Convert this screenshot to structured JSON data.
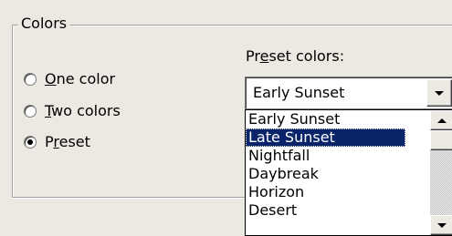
{
  "group": {
    "legend": "Colors"
  },
  "radios": [
    {
      "prefix": "",
      "mnemonic": "O",
      "rest": "ne color",
      "selected": false
    },
    {
      "prefix": "",
      "mnemonic": "T",
      "rest": "wo colors",
      "selected": false
    },
    {
      "prefix": "P",
      "mnemonic": "r",
      "rest": "eset",
      "selected": true
    }
  ],
  "preset": {
    "caption_prefix": "Pr",
    "caption_mnemonic": "e",
    "caption_rest": "set colors:",
    "selected_value": "Early Sunset",
    "options": [
      "Early Sunset",
      "Late Sunset",
      "Nightfall",
      "Daybreak",
      "Horizon",
      "Desert"
    ],
    "highlighted_option": "Late Sunset"
  },
  "colors": {
    "dialog_bg": "#ece9e3",
    "highlight": "#0a246a"
  }
}
